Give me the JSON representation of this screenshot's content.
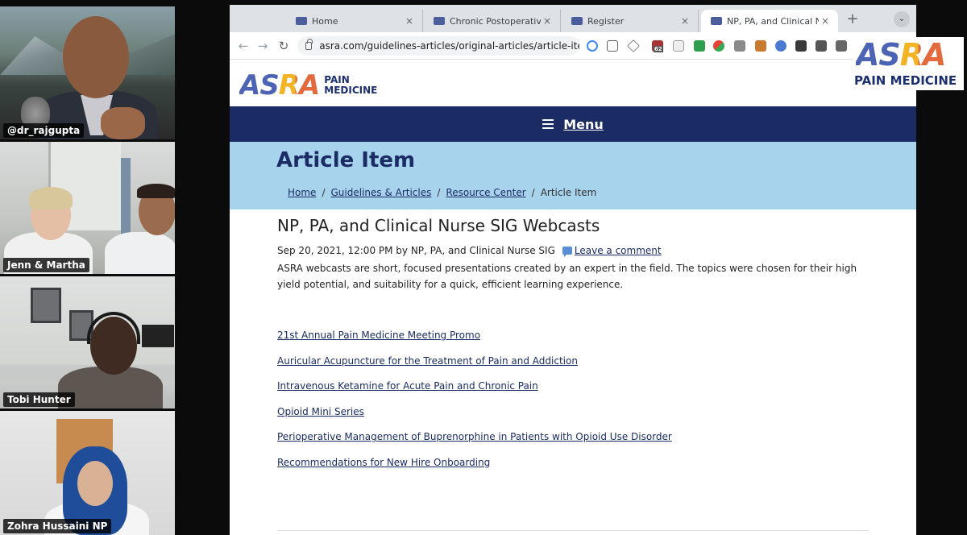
{
  "participants": [
    {
      "name": "@dr_rajgupta"
    },
    {
      "name": "Jenn & Martha"
    },
    {
      "name": "Tobi Hunter"
    },
    {
      "name": "Zohra Hussaini NP"
    }
  ],
  "browser": {
    "tabs": [
      {
        "title": "Home"
      },
      {
        "title": "Chronic Postoperative Pai"
      },
      {
        "title": "Register"
      },
      {
        "title": "NP, PA, and Clinical Nurse"
      }
    ],
    "close_glyph": "×",
    "new_tab_glyph": "+",
    "tab_search_glyph": "⌄",
    "nav": {
      "back": "←",
      "forward": "→",
      "reload": "↻"
    },
    "url": "asra.com/guidelines-articles/original-articles/article-item/w...",
    "extension_badge": "62"
  },
  "site": {
    "logo_word": "ASRA",
    "logo_sub_1": "PAIN",
    "logo_sub_2": "MEDICINE",
    "menu_label": "Menu",
    "hero_title": "Article Item",
    "breadcrumb": {
      "home": "Home",
      "sep": "/",
      "guidelines": "Guidelines & Articles",
      "resource": "Resource Center",
      "current": "Article Item"
    }
  },
  "article": {
    "title": "NP, PA, and Clinical Nurse SIG Webcasts",
    "meta": "Sep 20, 2021, 12:00 PM by NP, PA, and Clinical Nurse SIG",
    "comment_link": "Leave a comment",
    "summary": "ASRA webcasts are short, focused presentations created by an expert in the field. The topics were chosen for their high yield potential, and suitability for a quick, efficient learning experience.",
    "links": [
      "21st Annual Pain Medicine Meeting Promo",
      "Auricular Acupuncture for the Treatment of Pain and Addiction",
      "Intravenous Ketamine for Acute Pain and Chronic Pain",
      "Opioid Mini Series",
      "Perioperative Management of Buprenorphine in Patients with Opioid Use Disorder",
      "Recommendations for New Hire Onboarding"
    ]
  },
  "watermark": {
    "word": "ASRA",
    "sub": "PAIN MEDICINE"
  },
  "colors": {
    "navy": "#1a2c63",
    "hero_blue": "#a7d3ec",
    "asra_blue": "#4d63b3",
    "asra_yellow": "#f2b424",
    "asra_orange": "#e36a3c"
  }
}
